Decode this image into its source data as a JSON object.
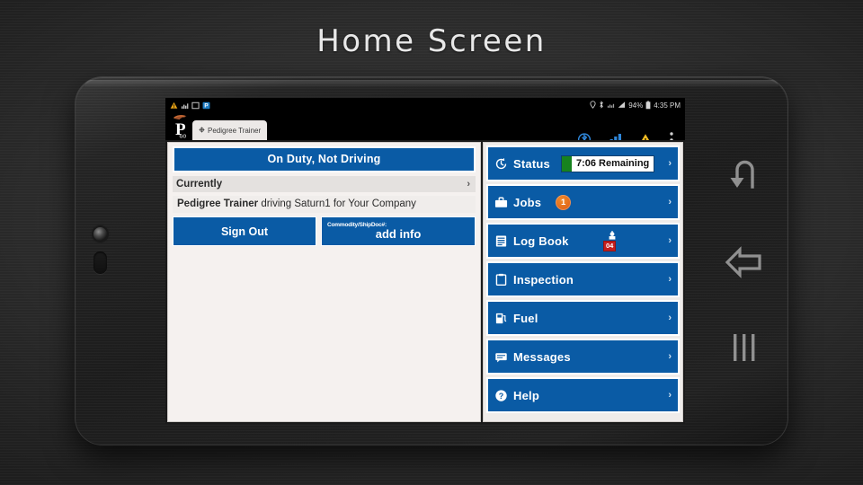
{
  "slide": {
    "title": "Home Screen"
  },
  "device": {
    "bezel_icons": [
      {
        "name": "camera-lens"
      },
      {
        "name": "home-button"
      }
    ],
    "nav_icons": [
      {
        "name": "return-arrow-icon",
        "glyph": "↶"
      },
      {
        "name": "back-arrow-icon",
        "glyph": "⇦"
      },
      {
        "name": "recent-apps-icon",
        "glyph": "|||"
      }
    ]
  },
  "android_status_bar": {
    "notification_icons": [
      "warning-triangle-icon",
      "signal-chart-icon",
      "square-app-icon",
      "pedigree-app-icon"
    ],
    "system_icons": [
      "location-icon",
      "bluetooth-icon",
      "wifi-icon",
      "cellular-signal-icon"
    ],
    "battery_percent": "94%",
    "clock": "4:35 PM"
  },
  "app_tab": {
    "title": "Pedigree Trainer",
    "logo_letter": "P",
    "logo_subtext": "GO"
  },
  "app_toolbar": {
    "icons": [
      "bluetooth-icon",
      "signal-bars-icon",
      "warning-triangle-icon",
      "overflow-menu-icon"
    ]
  },
  "left_panel": {
    "duty_status": "On Duty, Not Driving",
    "currently_label": "Currently",
    "currently_chevron": "›",
    "driver_name": "Pedigree Trainer",
    "driver_activity": " driving Saturn1 for Your Company",
    "sign_out_label": "Sign Out",
    "commodity_label": "Commodity/ShipDoc#:",
    "commodity_value": "add info"
  },
  "menu": {
    "chevron": "›",
    "items": [
      {
        "id": "status",
        "label": "Status",
        "icon": "clock-refresh-icon",
        "badge_type": "pill",
        "pill_text": "7:06 Remaining",
        "pill_swatch_color": "#17821f"
      },
      {
        "id": "jobs",
        "label": "Jobs",
        "icon": "briefcase-icon",
        "badge_type": "count",
        "badge_count": "1",
        "badge_color": "#e2671a"
      },
      {
        "id": "logbook",
        "label": "Log Book",
        "icon": "logbook-lines-icon",
        "badge_type": "icon-count",
        "badge_count": "04",
        "badge_color": "#c41e1e"
      },
      {
        "id": "inspection",
        "label": "Inspection",
        "icon": "clipboard-icon",
        "badge_type": "none"
      },
      {
        "id": "fuel",
        "label": "Fuel",
        "icon": "fuel-pump-icon",
        "badge_type": "none"
      },
      {
        "id": "messages",
        "label": "Messages",
        "icon": "message-icon",
        "badge_type": "none"
      },
      {
        "id": "help",
        "label": "Help",
        "icon": "help-circle-icon",
        "badge_type": "none"
      }
    ]
  },
  "colors": {
    "brand_blue": "#0a5ba5",
    "panel_bg": "#f5f1ef",
    "badge_orange": "#e2671a",
    "badge_red": "#c41e1e",
    "status_green": "#17821f"
  }
}
